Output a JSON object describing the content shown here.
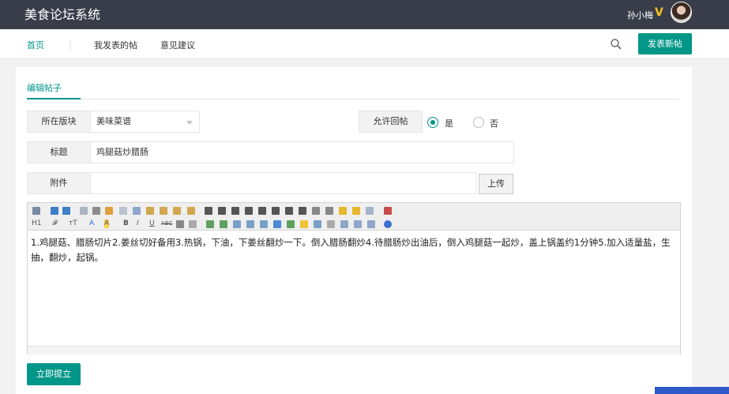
{
  "header": {
    "brand": "美食论坛系统",
    "user_name": "孙小梅",
    "vip_mark": "V"
  },
  "nav": {
    "items": [
      "首页",
      "我发表的帖",
      "意见建议"
    ],
    "separator": "|",
    "new_post": "发表新帖"
  },
  "tab": {
    "label": "编辑帖子"
  },
  "form": {
    "board_label": "所在版块",
    "board_value": "美味菜谱",
    "reply_label": "允许回帖",
    "reply_yes": "是",
    "reply_no": "否",
    "reply_selected": "是",
    "title_label": "标题",
    "title_value": "鸡腿菇炒腊肠",
    "attach_label": "附件",
    "attach_value": "",
    "upload_label": "上传",
    "content": "1.鸡腿菇、腊肠切片2.姜丝切好备用3.热锅，下油，下姜丝翻炒一下。倒入腊肠翻炒4.待腊肠炒出油后，倒入鸡腿菇一起炒，盖上锅盖约1分钟5.加入适量盐，生抽，翻炒，起锅。",
    "submit_label": "立即提立"
  },
  "toolbar": {
    "row1_icons": [
      "source",
      "undo",
      "redo",
      "preview",
      "print",
      "template",
      "cut",
      "copy",
      "paste",
      "paste-text",
      "paste-word",
      "align-left",
      "align-center",
      "align-right",
      "justify",
      "ordered-list",
      "unordered-list",
      "indent",
      "outdent",
      "subscript",
      "superscript",
      "clear",
      "select-all",
      "fullscreen"
    ],
    "row2_text": [
      "H1",
      "𝓕",
      "тT",
      "A",
      "A",
      "B",
      "I",
      "U",
      "ABC"
    ]
  },
  "colors": {
    "header": "#393d49",
    "accent": "#009688"
  }
}
